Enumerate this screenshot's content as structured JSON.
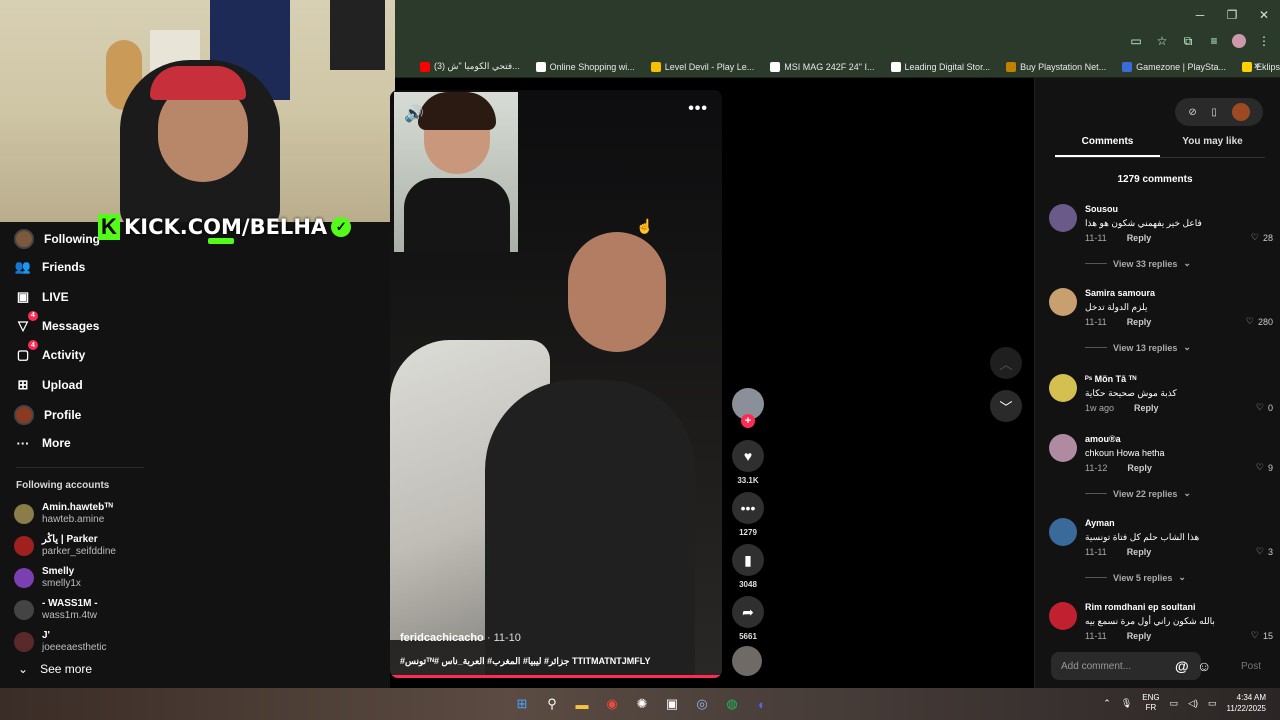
{
  "colors": {
    "accent": "#fe2c55",
    "kick_green": "#53fc18",
    "sidebar_bg": "#121212"
  },
  "bookmarks": [
    {
      "label": "(3) فتحي الكوميا \"ش...",
      "color": "#ff0000"
    },
    {
      "label": "Online Shopping wi...",
      "color": "#ffffff"
    },
    {
      "label": "Level Devil - Play Le...",
      "color": "#f5c000"
    },
    {
      "label": "MSI MAG 242F 24\" I...",
      "color": "#ffffff"
    },
    {
      "label": "Leading Digital Stor...",
      "color": "#ffffff"
    },
    {
      "label": "Buy Playstation Net...",
      "color": "#c08000"
    },
    {
      "label": "Gamezone | PlaySta...",
      "color": "#3a6bd8"
    },
    {
      "label": "Eklipse - Convert Tw...",
      "color": "#ffd000"
    }
  ],
  "kick_overlay": {
    "text": "KICK.COM/BELHA"
  },
  "nav": [
    {
      "label": "Following",
      "icon": "avatar-icon"
    },
    {
      "label": "Friends",
      "icon": "friends-icon"
    },
    {
      "label": "LIVE",
      "icon": "live-icon"
    },
    {
      "label": "Messages",
      "icon": "messages-icon",
      "badge": "4"
    },
    {
      "label": "Activity",
      "icon": "activity-icon",
      "badge": "4"
    },
    {
      "label": "Upload",
      "icon": "upload-icon"
    },
    {
      "label": "Profile",
      "icon": "profile-icon"
    },
    {
      "label": "More",
      "icon": "more-icon"
    }
  ],
  "following_title": "Following accounts",
  "following_accounts": [
    {
      "name": "Amin.hawtebᵀᴺ",
      "handle": "hawteb.amine",
      "color": "#8b7d4a"
    },
    {
      "name": "ياڭر | Parker",
      "handle": "parker_seifddine",
      "color": "#a02020"
    },
    {
      "name": "Smelly",
      "handle": "smelly1x",
      "color": "#7a3fb0"
    },
    {
      "name": "- WASS1M -",
      "handle": "wass1m.4tw",
      "color": "#444444"
    },
    {
      "name": "J'",
      "handle": "joeeeaesthetic",
      "color": "#5a2a2a"
    }
  ],
  "see_more": "See more",
  "video": {
    "author": "feridcachicacho",
    "date": "11-10",
    "tags": "#تونسᵀᴺ# جزائر# ليبيا# المغرب# العربة_ناس TTITMATNTJMFLY"
  },
  "actions": {
    "likes": "33.1K",
    "comments": "1279",
    "saves": "3048",
    "shares": "5661"
  },
  "panel": {
    "tab_comments": "Comments",
    "tab_you_may_like": "You may like",
    "comment_count": "1279 comments",
    "add_comment_placeholder": "Add comment...",
    "post_label": "Post",
    "reply_label": "Reply"
  },
  "comments": [
    {
      "name": "Sousou",
      "text": "فاعل خير يفهمني شكون هو هذا",
      "date": "11-11",
      "likes": "28",
      "replies": "View 33 replies",
      "color": "#6a5a8a"
    },
    {
      "name": "Samira samoura",
      "text": "يلزم الدولة تدخل",
      "date": "11-11",
      "likes": "280",
      "replies": "View 13 replies",
      "color": "#c8a070"
    },
    {
      "name": "ᴾˢ Mõn Tã ᵀᴺ",
      "text": "كذبة موش صحيحة حكاية",
      "date": "1w ago",
      "likes": "0",
      "replies": "",
      "color": "#d4c050"
    },
    {
      "name": "amou®a",
      "text": "chkoun Howa hetha",
      "date": "11-12",
      "likes": "9",
      "replies": "View 22 replies",
      "color": "#b08aa0"
    },
    {
      "name": "Ayman",
      "text": "هذا الشاب حلم كل فتاة تونسية",
      "date": "11-11",
      "likes": "3",
      "replies": "View 5 replies",
      "color": "#3a6a9a"
    },
    {
      "name": "Rim romdhani ep soultani",
      "text": "بالله شكون راني أول مرة نسمع بيه",
      "date": "11-11",
      "likes": "15",
      "replies": "",
      "color": "#c02030"
    }
  ],
  "taskbar": {
    "lang_top": "ENG",
    "lang_bottom": "FR",
    "time": "4:34 AM",
    "date": "11/22/2025"
  }
}
